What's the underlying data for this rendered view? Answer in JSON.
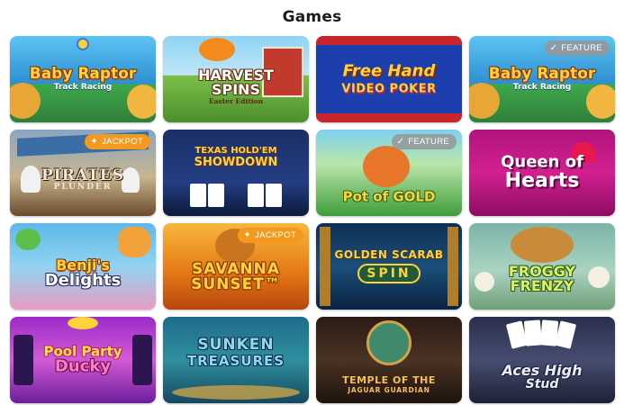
{
  "page": {
    "title": "Games"
  },
  "games": [
    {
      "name": "Baby Raptor Track Racing",
      "logo_line1": "Baby Raptor",
      "logo_line2": "Track Racing",
      "badge": null
    },
    {
      "name": "Harvest Spins Easter Edition",
      "logo_line1": "HARVEST",
      "logo_line2": "SPINS",
      "logo_line3": "Easter Edition",
      "badge": null
    },
    {
      "name": "Free Hand Video Poker",
      "logo_line1": "Free Hand",
      "logo_line2": "VIDEO POKER",
      "badge": null
    },
    {
      "name": "Baby Raptor Track Racing",
      "logo_line1": "Baby Raptor",
      "logo_line2": "Track Racing",
      "badge": "FEATURE"
    },
    {
      "name": "Pirates Plunder",
      "logo_line1": "PIRATES",
      "logo_line2": "PLUNDER",
      "badge": "JACKPOT"
    },
    {
      "name": "Texas Hold'em Showdown",
      "logo_line1": "TEXAS HOLD'EM",
      "logo_line2": "SHOWDOWN",
      "badge": null
    },
    {
      "name": "Pot of Gold",
      "logo_line1": "Pot of GOLD",
      "badge": "FEATURE"
    },
    {
      "name": "Queen of Hearts",
      "logo_line1": "Queen of",
      "logo_line2": "Hearts",
      "badge": null
    },
    {
      "name": "Benji's Delights",
      "logo_line1": "Benji's",
      "logo_line2": "Delights",
      "badge": null
    },
    {
      "name": "Savanna Sunset",
      "logo_line1": "SAVANNA",
      "logo_line2": "SUNSET™",
      "badge": "JACKPOT"
    },
    {
      "name": "Golden Scarab Spin",
      "logo_line1": "GOLDEN SCARAB",
      "logo_line2": "SPIN",
      "badge": null
    },
    {
      "name": "Froggy Frenzy",
      "logo_line1": "FROGGY",
      "logo_line2": "FRENZY",
      "badge": null
    },
    {
      "name": "Pool Party Ducky",
      "logo_line1": "Pool Party",
      "logo_line2": "Ducky",
      "badge": null
    },
    {
      "name": "Sunken Treasures",
      "logo_line1": "SUNKEN",
      "logo_line2": "TREASURES",
      "badge": null
    },
    {
      "name": "Temple of the Jaguar Guardian",
      "logo_line1": "TEMPLE OF THE",
      "logo_line2": "JAGUAR GUARDIAN",
      "badge": null
    },
    {
      "name": "Aces High Stud",
      "logo_line1": "Aces High",
      "logo_line2": "Stud",
      "badge": null
    }
  ],
  "badges": {
    "feature": "FEATURE",
    "jackpot": "JACKPOT"
  },
  "colors": {
    "jackpot": "#f39a1e",
    "feature": "#969696",
    "title": "#1c1c1c"
  }
}
